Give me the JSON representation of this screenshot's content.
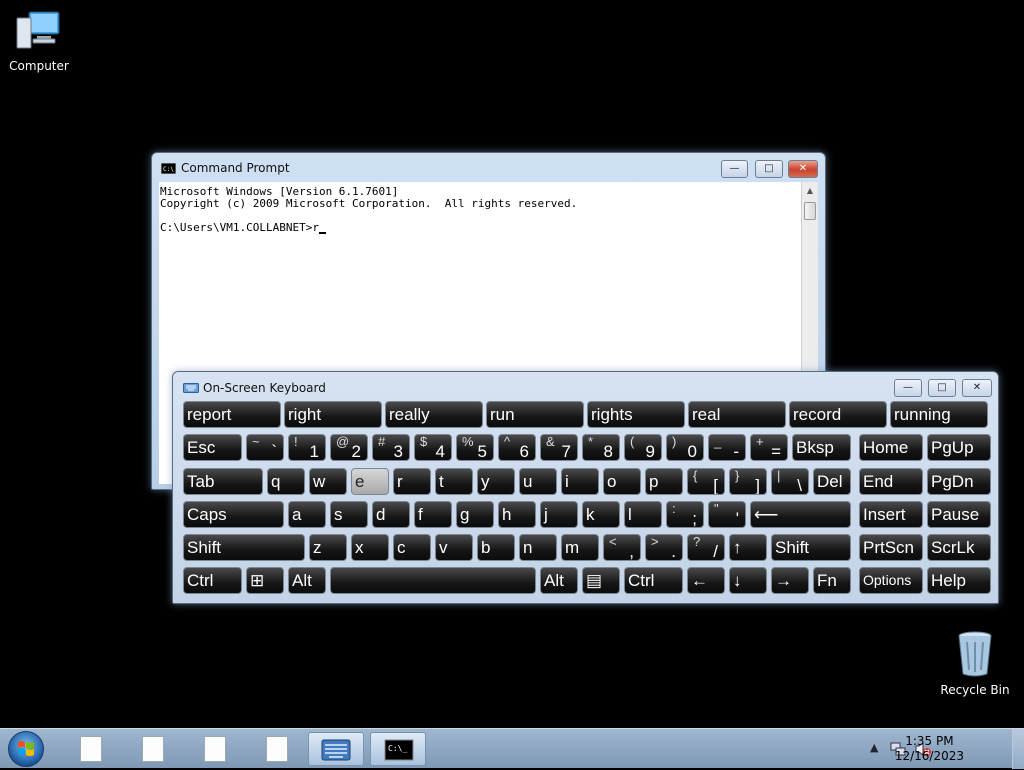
{
  "desktop": {
    "icons": [
      {
        "label": "Computer",
        "icon": "computer-icon"
      },
      {
        "label": "Recycle Bin",
        "icon": "recycle-bin-icon"
      }
    ]
  },
  "cmd_window": {
    "title": "Command Prompt",
    "lines": [
      "Microsoft Windows [Version 6.1.7601]",
      "Copyright (c) 2009 Microsoft Corporation.  All rights reserved.",
      "",
      "C:\\Users\\VM1.COLLABNET>r"
    ],
    "controls": {
      "minimize": "—",
      "maximize": "□",
      "close": "✕"
    }
  },
  "osk_window": {
    "title": "On-Screen Keyboard",
    "predictions": [
      "report",
      "right",
      "really",
      "run",
      "rights",
      "real",
      "record",
      "running"
    ],
    "highlighted_key": "e",
    "rows": [
      [
        {
          "m": "Esc"
        },
        {
          "m": "`",
          "s": "~"
        },
        {
          "m": "1",
          "s": "!"
        },
        {
          "m": "2",
          "s": "@"
        },
        {
          "m": "3",
          "s": "#"
        },
        {
          "m": "4",
          "s": "$"
        },
        {
          "m": "5",
          "s": "%"
        },
        {
          "m": "6",
          "s": "^"
        },
        {
          "m": "7",
          "s": "&"
        },
        {
          "m": "8",
          "s": "*"
        },
        {
          "m": "9",
          "s": "("
        },
        {
          "m": "0",
          "s": ")"
        },
        {
          "m": "-",
          "s": "_"
        },
        {
          "m": "=",
          "s": "+"
        },
        {
          "m": "Bksp"
        },
        {
          "m": "Home"
        },
        {
          "m": "PgUp"
        }
      ],
      [
        {
          "m": "Tab"
        },
        {
          "m": "q"
        },
        {
          "m": "w"
        },
        {
          "m": "e"
        },
        {
          "m": "r"
        },
        {
          "m": "t"
        },
        {
          "m": "y"
        },
        {
          "m": "u"
        },
        {
          "m": "i"
        },
        {
          "m": "o"
        },
        {
          "m": "p"
        },
        {
          "m": "[",
          "s": "{"
        },
        {
          "m": "]",
          "s": "}"
        },
        {
          "m": "\\",
          "s": "|"
        },
        {
          "m": "Del"
        },
        {
          "m": "End"
        },
        {
          "m": "PgDn"
        }
      ],
      [
        {
          "m": "Caps"
        },
        {
          "m": "a"
        },
        {
          "m": "s"
        },
        {
          "m": "d"
        },
        {
          "m": "f"
        },
        {
          "m": "g"
        },
        {
          "m": "h"
        },
        {
          "m": "j"
        },
        {
          "m": "k"
        },
        {
          "m": "l"
        },
        {
          "m": ";",
          "s": ":"
        },
        {
          "m": "'",
          "s": "\""
        },
        {
          "m": "⟵"
        },
        {
          "m": "Insert"
        },
        {
          "m": "Pause"
        }
      ],
      [
        {
          "m": "Shift"
        },
        {
          "m": "z"
        },
        {
          "m": "x"
        },
        {
          "m": "c"
        },
        {
          "m": "v"
        },
        {
          "m": "b"
        },
        {
          "m": "n"
        },
        {
          "m": "m"
        },
        {
          "m": ",",
          "s": "<"
        },
        {
          "m": ".",
          "s": ">"
        },
        {
          "m": "/",
          "s": "?"
        },
        {
          "m": "↑"
        },
        {
          "m": "Shift"
        },
        {
          "m": "PrtScn"
        },
        {
          "m": "ScrLk"
        }
      ],
      [
        {
          "m": "Ctrl"
        },
        {
          "m": "⊞"
        },
        {
          "m": "Alt"
        },
        {
          "m": ""
        },
        {
          "m": "Alt"
        },
        {
          "m": "▤"
        },
        {
          "m": "Ctrl"
        },
        {
          "m": "←"
        },
        {
          "m": "↓"
        },
        {
          "m": "→"
        },
        {
          "m": "Fn"
        },
        {
          "m": "Options"
        },
        {
          "m": "Help"
        }
      ]
    ]
  },
  "taskbar": {
    "pinned": [
      "document-icon",
      "document-icon",
      "document-icon",
      "document-icon",
      "on-screen-keyboard-icon",
      "command-prompt-icon"
    ],
    "clock_time": "1:35 PM",
    "clock_date": "12/16/2023",
    "tray_expand": "▲"
  }
}
